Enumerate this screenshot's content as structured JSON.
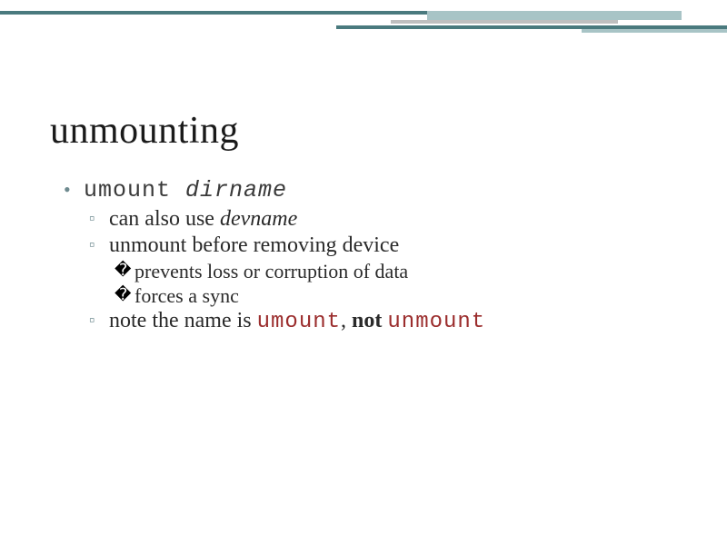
{
  "decor": {
    "teal": "#4a7a7e",
    "light_teal": "#a8c4c6",
    "gray": "#bfbfbf"
  },
  "title": "unmounting",
  "bullets": {
    "l1_cmd_part1": "umount ",
    "l1_cmd_part2": "dirname",
    "l2a_prefix": "can also use ",
    "l2a_dev": "devname",
    "l2b": "unmount before removing device",
    "l3a": "prevents loss or corruption of data",
    "l3b": "forces a sync",
    "l2c_prefix": "note the name is ",
    "l2c_umount": "umount",
    "l2c_sep": ", ",
    "l2c_not": "not",
    "l2c_space": " ",
    "l2c_unmount": "unmount"
  }
}
